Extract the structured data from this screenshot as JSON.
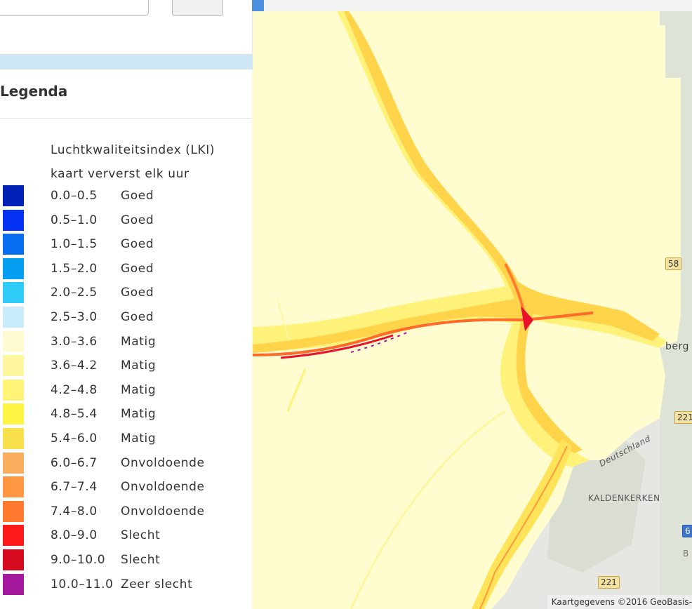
{
  "map": {
    "road_labels": [
      "58",
      "221",
      "221",
      "6"
    ],
    "place_labels": [
      "KALDENKERKEN",
      "Deutschland",
      "berg",
      "B"
    ],
    "attribution": "Kaartgegevens ©2016 GeoBasis-"
  },
  "legend": {
    "title": "Legenda",
    "subtitle": "Luchtkwaliteitsindex (LKI)",
    "refresh_note": "kaart ververst elk uur",
    "items": [
      {
        "range": "0.0–0.5",
        "quality": "Goed",
        "color": "#0021b5"
      },
      {
        "range": "0.5–1.0",
        "quality": "Goed",
        "color": "#0432f5"
      },
      {
        "range": "1.0–1.5",
        "quality": "Goed",
        "color": "#0a6ef2"
      },
      {
        "range": "1.5–2.0",
        "quality": "Goed",
        "color": "#049ff0"
      },
      {
        "range": "2.0–2.5",
        "quality": "Goed",
        "color": "#2ecbf7"
      },
      {
        "range": "2.5–3.0",
        "quality": "Goed",
        "color": "#c9ecfc"
      },
      {
        "range": "3.0–3.6",
        "quality": "Matig",
        "color": "#fffbd1"
      },
      {
        "range": "3.6–4.2",
        "quality": "Matig",
        "color": "#fff7a0"
      },
      {
        "range": "4.2–4.8",
        "quality": "Matig",
        "color": "#fff475"
      },
      {
        "range": "4.8–5.4",
        "quality": "Matig",
        "color": "#fff443"
      },
      {
        "range": "5.4–6.0",
        "quality": "Matig",
        "color": "#f8e04c"
      },
      {
        "range": "6.0–6.7",
        "quality": "Onvoldoende",
        "color": "#fbad5e"
      },
      {
        "range": "6.7–7.4",
        "quality": "Onvoldoende",
        "color": "#ff9642"
      },
      {
        "range": "7.4–8.0",
        "quality": "Onvoldoende",
        "color": "#ff7a2f"
      },
      {
        "range": "8.0–9.0",
        "quality": "Slecht",
        "color": "#ff1a1a"
      },
      {
        "range": "9.0–10.0",
        "quality": "Slecht",
        "color": "#d60a1f"
      },
      {
        "range": "10.0–11.0",
        "quality": "Zeer slecht",
        "color": "#a3189c"
      }
    ]
  }
}
